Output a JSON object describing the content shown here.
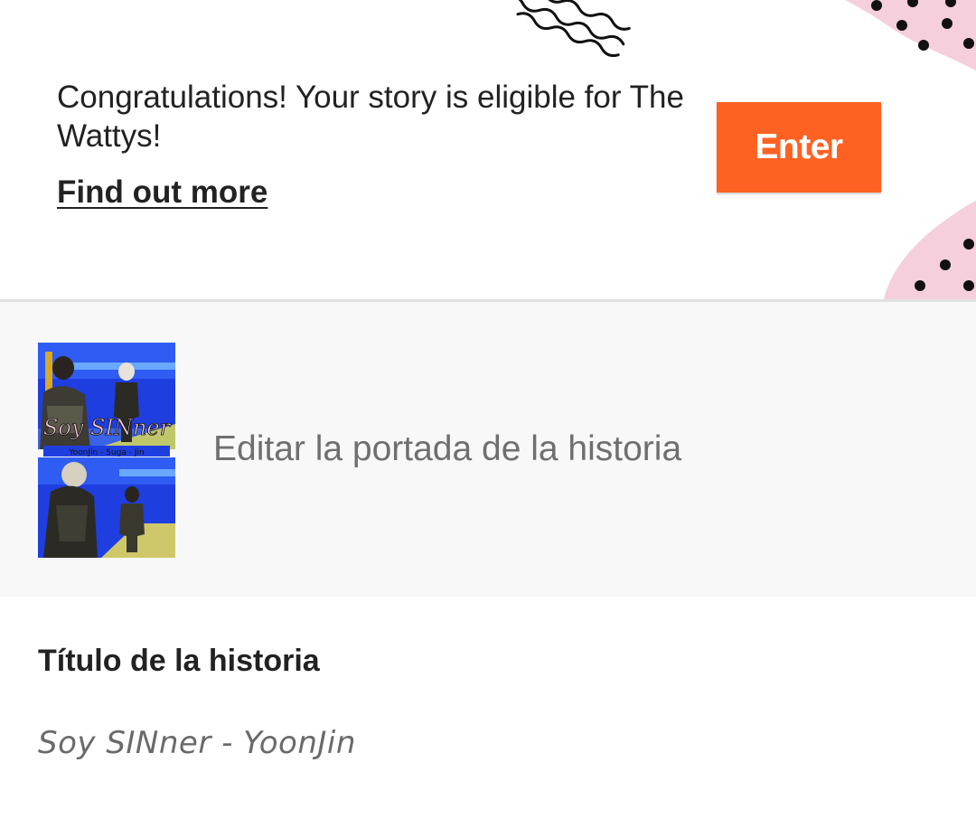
{
  "banner": {
    "message": "Congratulations! Your story is eligible for The Wattys!",
    "link_label": "Find out more",
    "button_label": "Enter",
    "accent_color": "#fd6223",
    "decoration_color": "#f5cfdc"
  },
  "cover": {
    "edit_label": "Editar la portada de la historia",
    "icon": "story-cover-image",
    "cover_text": "Soy SINner",
    "cover_subtext": "YoonJin - Suga - Jin"
  },
  "story": {
    "title_heading": "Título de la historia",
    "title_value": "Soy SINner - YoonJin"
  }
}
